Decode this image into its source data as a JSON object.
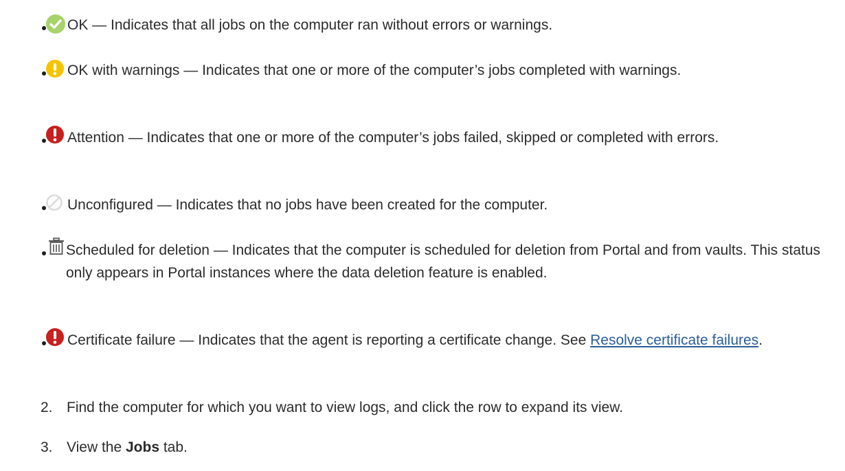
{
  "bullets": [
    {
      "icon": "check-circle-icon",
      "text": "OK — Indicates that all jobs on the computer ran without errors or warnings."
    },
    {
      "icon": "warning-icon",
      "text": "OK with warnings — Indicates that one or more of the computer’s jobs completed with warnings."
    },
    {
      "icon": "attention-icon",
      "text": "Attention — Indicates that one or more of the computer’s jobs failed, skipped or completed with errors."
    },
    {
      "icon": "unconfigured-icon",
      "text": "Unconfigured — Indicates that no jobs have been created for the computer."
    },
    {
      "icon": "trash-icon",
      "text": "Scheduled for deletion — Indicates that the computer is scheduled for deletion from Portal and from vaults. This status only appears in Portal instances where the data deletion feature is enabled."
    },
    {
      "icon": "certificate-failure-icon",
      "text": "Certificate failure — Indicates that the agent is reporting a certificate change. See ",
      "link": "Resolve certificate failures",
      "suffix": "."
    }
  ],
  "steps": [
    {
      "number": "2.",
      "text": "Find the computer for which you want to view logs, and click the row to expand its view."
    },
    {
      "number": "3.",
      "prefix": "View the ",
      "bold": "Jobs",
      "suffix": " tab."
    }
  ],
  "colors": {
    "ok": "#a6d36b",
    "warning": "#f5c400",
    "attention": "#c8201e",
    "unconfigured": "#dcdcdc",
    "trash": "#555555",
    "link": "#2a5d9a"
  }
}
